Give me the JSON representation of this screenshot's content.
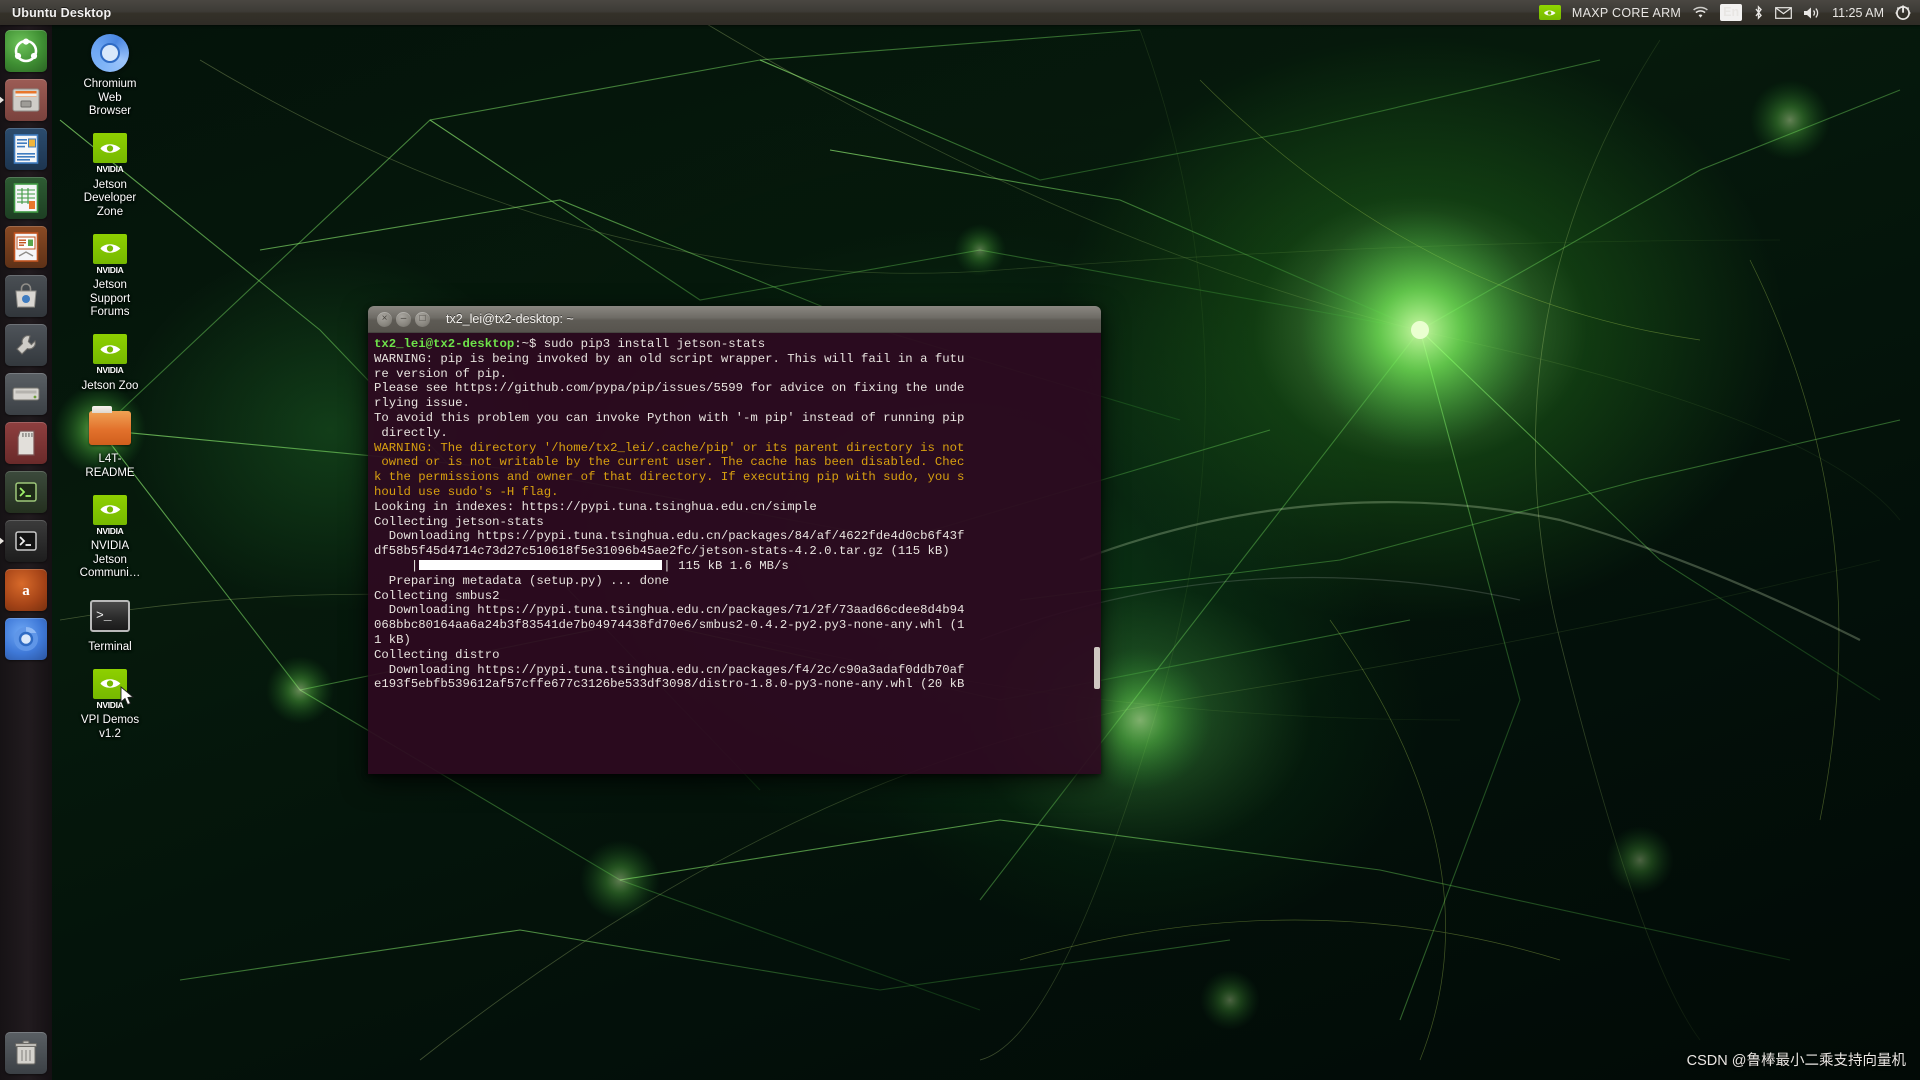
{
  "panel": {
    "title": "Ubuntu Desktop",
    "indicators": {
      "nvidia_icon": "nvidia-eye-icon",
      "maxp_label": "MAXP CORE ARM",
      "wifi_icon": "wifi-icon",
      "keyboard_layout": "En",
      "bluetooth_icon": "bluetooth-icon",
      "mail_icon": "envelope-icon",
      "volume_icon": "speaker-icon",
      "clock": "11:25 AM",
      "session_icon": "gear-power-icon"
    }
  },
  "launcher": {
    "items": [
      {
        "name": "ubuntu-dash",
        "label": "Ubuntu Dash",
        "icon": "ubuntu-logo-icon",
        "class": "ic-ubuntu",
        "running": false
      },
      {
        "name": "files",
        "label": "Files",
        "icon": "file-cabinet-icon",
        "class": "ic-files",
        "running": true
      },
      {
        "name": "libreoffice-writer",
        "label": "LibreOffice Writer",
        "icon": "document-icon",
        "class": "ic-writer",
        "running": false
      },
      {
        "name": "libreoffice-calc",
        "label": "LibreOffice Calc",
        "icon": "spreadsheet-icon",
        "class": "ic-calc",
        "running": false
      },
      {
        "name": "libreoffice-impress",
        "label": "LibreOffice Impress",
        "icon": "presentation-icon",
        "class": "ic-impress",
        "running": false
      },
      {
        "name": "ubuntu-software",
        "label": "Ubuntu Software",
        "icon": "software-bag-icon",
        "class": "ic-amazon",
        "running": false
      },
      {
        "name": "system-settings",
        "label": "System Settings",
        "icon": "wrench-icon",
        "class": "ic-settings",
        "running": false
      },
      {
        "name": "disks",
        "label": "Disks",
        "icon": "hard-disk-icon",
        "class": "ic-disk",
        "running": false
      },
      {
        "name": "sd-card",
        "label": "SD Card",
        "icon": "sd-card-icon",
        "class": "ic-sd",
        "running": false
      },
      {
        "name": "terminal-launcher-green",
        "label": "Terminal",
        "icon": "terminal-icon",
        "class": "ic-term2",
        "running": false
      },
      {
        "name": "terminal-launcher",
        "label": "Terminal",
        "icon": "terminal-prompt-icon",
        "class": "ic-term",
        "running": true
      },
      {
        "name": "amazon",
        "label": "Amazon",
        "icon": "amazon-icon",
        "class": "ic-amazon2",
        "running": false
      },
      {
        "name": "chromium",
        "label": "Chromium",
        "icon": "chromium-icon",
        "class": "ic-chrome",
        "running": false
      }
    ],
    "trash": {
      "name": "trash",
      "label": "Trash",
      "icon": "trash-bin-icon",
      "class": "ic-trash"
    }
  },
  "desktop_icons": [
    {
      "label": "Chromium Web Browser",
      "glyph": "chromium-icon"
    },
    {
      "label": "NVIDIA Jetson Developer Zone",
      "glyph": "nvidia-icon",
      "short": "Jetson\nDeveloper\nZone"
    },
    {
      "label": "NVIDIA Jetson Support Forums",
      "glyph": "nvidia-icon",
      "short": "Jetson\nSupport\nForums"
    },
    {
      "label": "NVIDIA Jetson Zoo",
      "glyph": "nvidia-icon",
      "short": "Jetson Zoo"
    },
    {
      "label": "L4T-README",
      "glyph": "folder-icon"
    },
    {
      "label": "NVIDIA Jetson Communi…",
      "glyph": "nvidia-icon",
      "short": "NVIDIA\nJetson\nCommuni…"
    },
    {
      "label": "Terminal",
      "glyph": "terminal-icon"
    },
    {
      "label": "NVIDIA VPI Demos v1.2",
      "glyph": "nvidia-icon",
      "short": "VPI Demos\nv1.2"
    }
  ],
  "desktop_icon_labels": {
    "chromium": "Chromium\nWeb\nBrowser",
    "jetson_dev_zone": "Jetson\nDeveloper\nZone",
    "jetson_support": "Jetson\nSupport\nForums",
    "jetson_zoo": "Jetson Zoo",
    "l4t_readme": "L4T-\nREADME",
    "jetson_community": "NVIDIA\nJetson\nCommuni…",
    "terminal": "Terminal",
    "vpi_demos": "VPI Demos\nv1.2",
    "nvidia_wordmark": "NVIDIA"
  },
  "terminal": {
    "title": "tx2_lei@tx2-desktop: ~",
    "buttons": {
      "close": "×",
      "minimize": "–",
      "maximize": "□"
    },
    "prompt_user": "tx2_lei@tx2-desktop",
    "prompt_path": ":~$ ",
    "command": "sudo pip3 install jetson-stats",
    "lines": [
      "WARNING: pip is being invoked by an old script wrapper. This will fail in a futu",
      "re version of pip.",
      "Please see https://github.com/pypa/pip/issues/5599 for advice on fixing the unde",
      "rlying issue.",
      "To avoid this problem you can invoke Python with '-m pip' instead of running pip",
      " directly."
    ],
    "warning_lines": [
      "WARNING: The directory '/home/tx2_lei/.cache/pip' or its parent directory is not",
      " owned or is not writable by the current user. The cache has been disabled. Chec",
      "k the permissions and owner of that directory. If executing pip with sudo, you s",
      "hould use sudo's -H flag."
    ],
    "lines2": [
      "Looking in indexes: https://pypi.tuna.tsinghua.edu.cn/simple",
      "Collecting jetson-stats",
      "  Downloading https://pypi.tuna.tsinghua.edu.cn/packages/84/af/4622fde4d0cb6f43f",
      "df58b5f45d4714c73d27c510618f5e31096b45ae2fc/jetson-stats-4.2.0.tar.gz (115 kB)"
    ],
    "progress_line": {
      "prefix": "     ",
      "bar_left": "|",
      "bar_right": "| ",
      "stats": "115 kB 1.6 MB/s"
    },
    "lines3": [
      "  Preparing metadata (setup.py) ... done",
      "Collecting smbus2",
      "  Downloading https://pypi.tuna.tsinghua.edu.cn/packages/71/2f/73aad66cdee8d4b94",
      "068bbc80164aa6a24b3f83541de7b04974438fd70e6/smbus2-0.4.2-py2.py3-none-any.whl (1",
      "1 kB)",
      "Collecting distro",
      "  Downloading https://pypi.tuna.tsinghua.edu.cn/packages/f4/2c/c90a3adaf0ddb70af",
      "e193f5ebfb539612af57cffe677c3126be533df3098/distro-1.8.0-py3-none-any.whl (20 kB"
    ]
  },
  "watermark": "CSDN @鲁棒最小二乘支持向量机",
  "colors": {
    "nvidia_green": "#76b900",
    "terminal_bg": "#2d0a20",
    "prompt_green": "#6ee34a",
    "warning_yellow": "#d8a010",
    "panel_bg": "#3c3a35"
  }
}
